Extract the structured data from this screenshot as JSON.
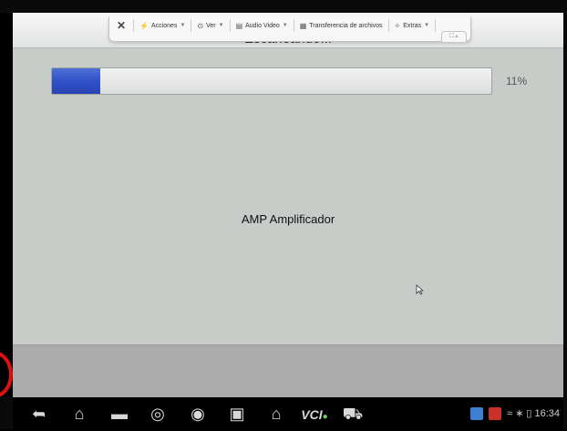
{
  "toolbar": {
    "close": "✕",
    "items": [
      {
        "icon": "⚡",
        "label": "Acciones"
      },
      {
        "icon": "⊙",
        "label": "Ver"
      },
      {
        "icon": "▤",
        "label": "Audio Video"
      },
      {
        "icon": "▦",
        "label": "Transferencia de archivos"
      },
      {
        "icon": "✧",
        "label": "Extras"
      }
    ],
    "caret": "▼",
    "tab": "⛶ ∧"
  },
  "screen": {
    "title": "Escaneando...",
    "progress": {
      "value": 11,
      "label": "11%"
    },
    "item": "AMP Amplificador"
  },
  "navbar": {
    "back": "➦",
    "home": "⌂",
    "recents": "▬",
    "browser": "◎",
    "camera": "◉",
    "screen_capture": "▣",
    "home_alt": "⌂",
    "vci": "VCI",
    "vci_dot": "●",
    "car": "⛟"
  },
  "status": {
    "wifi": "≈",
    "bluetooth": "∗",
    "battery": "▯",
    "time": "16:34"
  },
  "colors": {
    "screen_bg": "#c7ccc8",
    "progress_fill": "#2e4fc5",
    "annotation_ring": "#e01010"
  }
}
